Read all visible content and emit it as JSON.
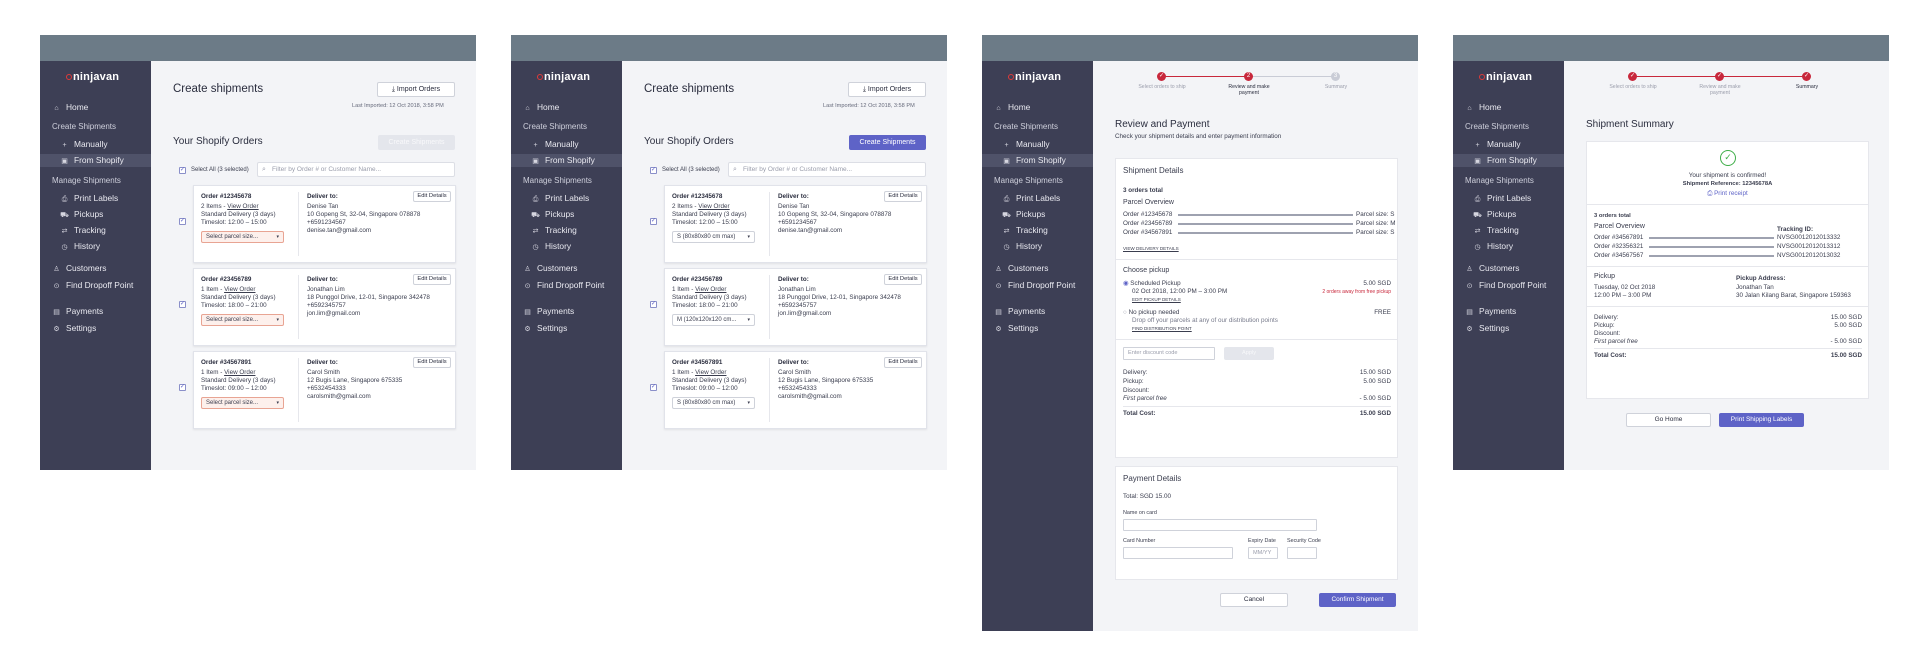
{
  "brand": {
    "name": "ninjavan",
    "accent": "#5e63c7",
    "danger": "#c8283c",
    "success": "#3fae49",
    "sidebar": "#3d3f55",
    "topbar": "#6c7b87"
  },
  "nav": {
    "home": "Home",
    "create_shipments": "Create Shipments",
    "manually": "Manually",
    "from_shopify": "From Shopify",
    "manage_shipments": "Manage Shipments",
    "print_labels": "Print Labels",
    "pickups": "Pickups",
    "tracking": "Tracking",
    "history": "History",
    "customers": "Customers",
    "find_dropoff": "Find Dropoff Point",
    "payments": "Payments",
    "settings": "Settings"
  },
  "create": {
    "title": "Create shipments",
    "import_btn": "Import Orders",
    "last_imported": "Last Imported: 12 Oct 2018, 3:58 PM",
    "orders_title": "Your Shopify Orders",
    "create_btn": "Create Shipments",
    "select_all": "Select All (3 selected)",
    "filter_placeholder": "Filter by Order # or Customer Name...",
    "edit_details": "Edit Details",
    "deliver_to": "Deliver to:",
    "view_order": "View Order",
    "orders": [
      {
        "order": "Order #12345678",
        "items": "2 Items - ",
        "service": "Standard Delivery (3 days)",
        "timeslot": "Timeslot: 12:00 – 15:00",
        "name": "Denise Tan",
        "address": "10 Gopeng St, 32-04, Singapore 078878",
        "phone": "+6591234567",
        "email": "denise.tan@gmail.com",
        "parcel_empty": "Select parcel size...",
        "parcel_selected": "S (80x80x80 cm max)"
      },
      {
        "order": "Order #23456789",
        "items": "1 Item - ",
        "service": "Standard Delivery (3 days)",
        "timeslot": "Timeslot: 18:00 – 21:00",
        "name": "Jonathan Lim",
        "address": "18 Punggol Drive, 12-01, Singapore 342478",
        "phone": "+6592345757",
        "email": "jon.lim@gmail.com",
        "parcel_empty": "Select parcel size...",
        "parcel_selected": "M (120x120x120 cm..."
      },
      {
        "order": "Order #34567891",
        "items": "1 Item - ",
        "service": "Standard Delivery (3 days)",
        "timeslot": "Timeslot: 09:00 – 12:00",
        "name": "Carol Smith",
        "address": "12 Bugis Lane, Singapore 675335",
        "phone": "+6532454333",
        "email": "carolsmith@gmail.com",
        "parcel_empty": "Select parcel size...",
        "parcel_selected": "S (80x80x80 cm max)"
      }
    ]
  },
  "steps": {
    "s1": "Select orders to ship",
    "s2": "Review and make payment",
    "s3": "Summary"
  },
  "review": {
    "title": "Review and Payment",
    "subtitle": "Check your shipment details and enter payment information",
    "details_title": "Shipment Details",
    "orders_total": "3 orders total",
    "parcel_overview": "Parcel Overview",
    "rows": [
      {
        "order": "Order #12345678",
        "size": "Parcel size: S"
      },
      {
        "order": "Order #23456789",
        "size": "Parcel size: M"
      },
      {
        "order": "Order #34567891",
        "size": "Parcel size: S"
      }
    ],
    "view_delivery": "VIEW DELIVERY DETAILS",
    "choose_pickup": "Choose pickup",
    "scheduled": "Scheduled Pickup",
    "scheduled_price": "5.00 SGD",
    "scheduled_date": "02 Oct 2018, 12:00 PM – 3:00 PM",
    "free_note": "2 orders away from free pickup",
    "edit_pickup": "EDIT PICKUP DETAILS",
    "no_pickup": "No pickup needed",
    "no_pickup_price": "FREE",
    "dropoff_note": "Drop off your parcels at any of our distribution points",
    "find_point": "FIND DISTRIBUTION POINT",
    "discount_placeholder": "Enter discount code",
    "apply": "Apply",
    "delivery": "Delivery:",
    "delivery_val": "15.00 SGD",
    "pickup": "Pickup:",
    "pickup_val": "5.00 SGD",
    "discount": "Discount:",
    "first_free": "First parcel free",
    "first_free_val": "- 5.00 SGD",
    "total": "Total Cost:",
    "total_val": "15.00 SGD",
    "payment_title": "Payment Details",
    "payment_total": "Total: SGD 15.00",
    "name_on_card": "Name on card",
    "card_number": "Card Number",
    "expiry": "Expiry Date",
    "expiry_placeholder": "MM/YY",
    "security": "Security Code",
    "cancel": "Cancel",
    "confirm": "Confirm Shipment"
  },
  "summary": {
    "title": "Shipment Summary",
    "confirmed": "Your shipment is confirmed!",
    "reference": "Shipment Reference: 12345678A",
    "print_receipt": "Print receipt",
    "orders_total": "3 orders total",
    "parcel_overview": "Parcel Overview",
    "tracking_id": "Tracking ID:",
    "rows": [
      {
        "order": "Order #34567891",
        "tid": "NVSG0012012013332"
      },
      {
        "order": "Order #32356321",
        "tid": "NVSG0012012013312"
      },
      {
        "order": "Order #34567567",
        "tid": "NVSG0012012013032"
      }
    ],
    "pickup": "Pickup",
    "pickup_date": "Tuesday, 02 Oct 2018",
    "pickup_time": "12:00 PM – 3:00 PM",
    "pickup_address_label": "Pickup Address:",
    "pickup_name": "Jonathan Tan",
    "pickup_address": "30 Jalan Kilang Barat, Singapore 159363",
    "delivery": "Delivery:",
    "delivery_val": "15.00 SGD",
    "pickup_cost": "Pickup:",
    "pickup_cost_val": "5.00 SGD",
    "discount": "Discount:",
    "first_free": "First parcel free",
    "first_free_val": "- 5.00 SGD",
    "total": "Total Cost:",
    "total_val": "15.00 SGD",
    "go_home": "Go Home",
    "print_labels": "Print Shipping Labels"
  }
}
